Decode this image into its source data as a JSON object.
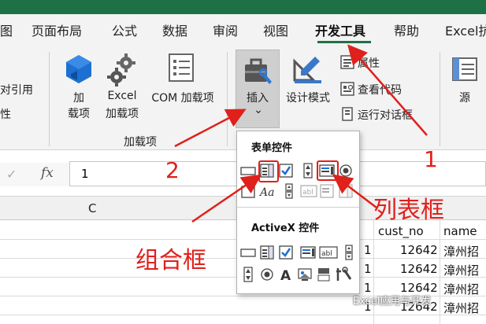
{
  "tabs": [
    {
      "label": "图"
    },
    {
      "label": "页面布局"
    },
    {
      "label": "公式"
    },
    {
      "label": "数据"
    },
    {
      "label": "审阅"
    },
    {
      "label": "视图"
    },
    {
      "label": "开发工具"
    },
    {
      "label": "帮助"
    },
    {
      "label": "Excel抗"
    }
  ],
  "ribbon": {
    "left_partial": [
      "对引用",
      "性"
    ],
    "addins_button_line1": "加",
    "addins_button_line2": "载项",
    "excel_addins_line1": "Excel",
    "excel_addins_line2": "加载项",
    "com_addins": "COM 加载项",
    "group_addins": "加载项",
    "insert": "插入",
    "insert_arrow": "⌄",
    "design_mode": "设计模式",
    "properties": "属性",
    "view_code": "查看代码",
    "run_dialog": "运行对话框",
    "source": "源"
  },
  "formula_bar": {
    "check": "✓",
    "fx": "fx",
    "value": "1"
  },
  "column_header": {
    "c": "C"
  },
  "grid": {
    "header_row": [
      "cust_no",
      "name"
    ],
    "rows": [
      {
        "a": "1",
        "cust_no": "12642",
        "name": "漳州招"
      },
      {
        "a": "1",
        "cust_no": "12642",
        "name": "漳州招"
      },
      {
        "a": "1",
        "cust_no": "12642",
        "name": "漳州招"
      },
      {
        "a": "1",
        "cust_no": "12642",
        "name": "漳州招"
      }
    ]
  },
  "dropdown": {
    "form_controls": "表单控件",
    "activex_controls": "ActiveX 控件"
  },
  "annotations": {
    "num1": "1",
    "num2": "2",
    "listbox": "列表框",
    "combobox": "组合框"
  },
  "watermark": "Excel应用与开发",
  "colors": {
    "accent": "#1e7145",
    "annotation": "#e0201b"
  }
}
